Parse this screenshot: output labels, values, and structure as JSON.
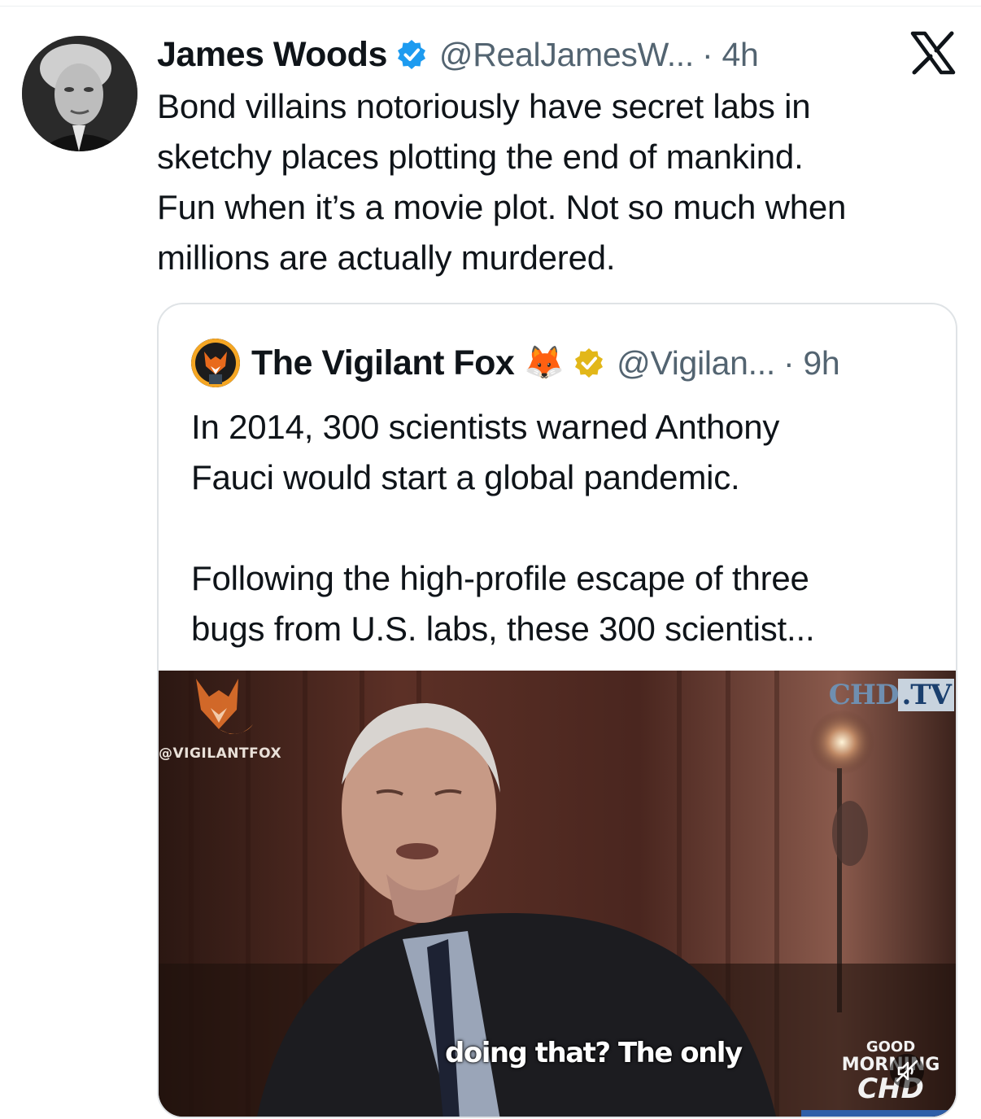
{
  "tweet": {
    "author_name": "James Woods",
    "handle": "@RealJamesW...",
    "time": "· 4h",
    "verified_badge": "blue-check-badge-icon",
    "lines": [
      "Bond villains notoriously have secret labs in",
      "sketchy places plotting the end of mankind.",
      "Fun when it’s a movie plot. Not so much when",
      "millions are actually murdered."
    ]
  },
  "platform_logo": "x-logo-icon",
  "quoted": {
    "author_name": "The Vigilant Fox",
    "emoji": "🦊",
    "verified_badge": "gold-check-badge-icon",
    "handle": "@Vigilan...",
    "time": "· 9h",
    "paragraph1": [
      "In 2014, 300 scientists warned Anthony",
      "Fauci would start a global pandemic."
    ],
    "paragraph2": [
      "Following the high-profile escape of three",
      "bugs from U.S. labs, these 300 scientist..."
    ],
    "media": {
      "watermark_text": "@VIGILANTFOX",
      "channel_tag_1": "CHD",
      "channel_tag_2": ".TV",
      "caption": "doing that? The only",
      "show_logo": [
        "GOOD",
        "MORNING",
        "CHD"
      ],
      "mute_icon": "muted-speaker-icon"
    }
  },
  "colors": {
    "text": "#0f1419",
    "secondary": "#536471",
    "verified_blue": "#1d9bf0",
    "verified_gold": "#e2b719",
    "border": "#dfe3e6"
  }
}
